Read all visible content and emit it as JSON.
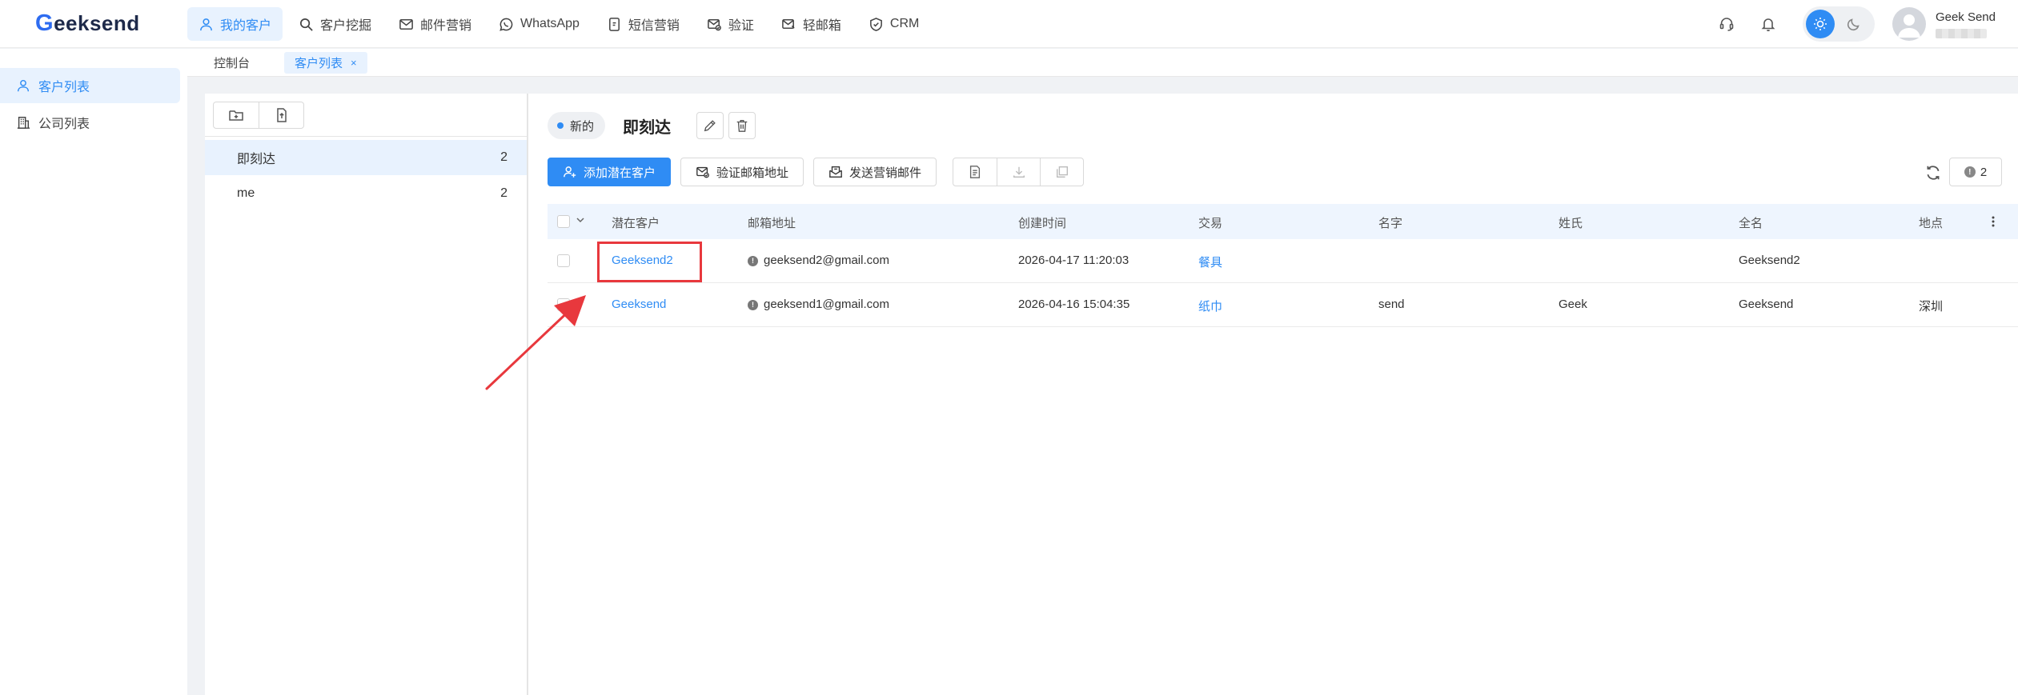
{
  "brand": {
    "logo_first": "G",
    "logo_rest": "eeksend"
  },
  "nav": [
    {
      "label": "我的客户",
      "icon": "user-icon",
      "active": true
    },
    {
      "label": "客户挖掘",
      "icon": "search-icon"
    },
    {
      "label": "邮件营销",
      "icon": "mail-icon"
    },
    {
      "label": "WhatsApp",
      "icon": "whatsapp-icon"
    },
    {
      "label": "短信营销",
      "icon": "sms-icon"
    },
    {
      "label": "验证",
      "icon": "verify-mail-icon"
    },
    {
      "label": "轻邮箱",
      "icon": "light-mail-icon"
    },
    {
      "label": "CRM",
      "icon": "crm-icon"
    }
  ],
  "user": {
    "name": "Geek Send"
  },
  "sidebar": [
    {
      "label": "客户列表",
      "icon": "user-icon",
      "active": true
    },
    {
      "label": "公司列表",
      "icon": "building-icon"
    }
  ],
  "tabs": [
    {
      "label": "控制台"
    },
    {
      "label": "客户列表",
      "active": true,
      "close": "×"
    }
  ],
  "groups": [
    {
      "name": "即刻达",
      "count": "2",
      "active": true
    },
    {
      "name": "me",
      "count": "2"
    }
  ],
  "detail": {
    "badge": "新的",
    "title": "即刻达",
    "count_badge": "2"
  },
  "actions": {
    "add": "添加潜在客户",
    "verify": "验证邮箱地址",
    "send": "发送营销邮件"
  },
  "table": {
    "headers": [
      "潜在客户",
      "邮箱地址",
      "创建时间",
      "交易",
      "名字",
      "姓氏",
      "全名",
      "地点"
    ],
    "rows": [
      {
        "prospect": "Geeksend2",
        "email": "geeksend2@gmail.com",
        "created": "2026-04-17 11:20:03",
        "deal": "餐具",
        "first": "",
        "last": "",
        "full": "Geeksend2",
        "location": ""
      },
      {
        "prospect": "Geeksend",
        "email": "geeksend1@gmail.com",
        "created": "2026-04-16 15:04:35",
        "deal": "纸巾",
        "first": "send",
        "last": "Geek",
        "full": "Geeksend",
        "location": "深圳"
      }
    ]
  },
  "colors": {
    "accent": "#2f8cf4",
    "highlight": "#e8383d"
  }
}
